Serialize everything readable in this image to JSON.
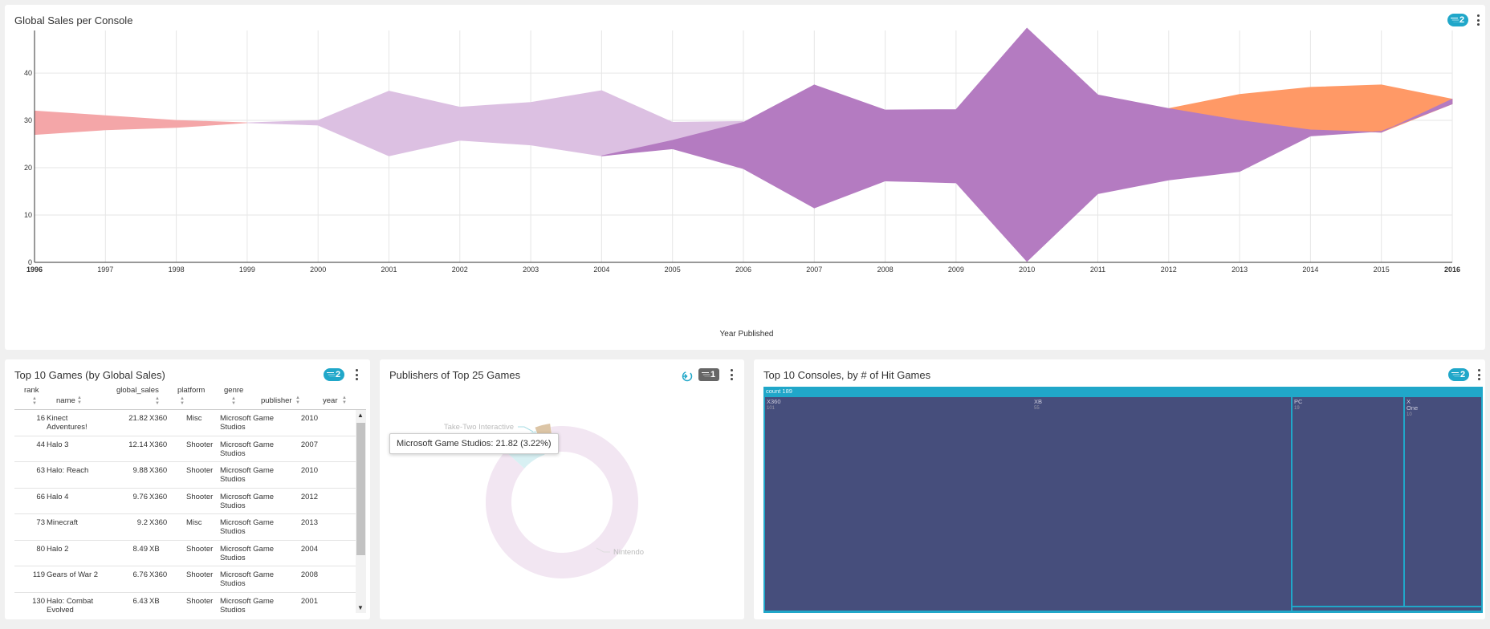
{
  "colors": {
    "accent": "#20a7c9",
    "series_pink": "#f4a6a8",
    "series_lavender": "#dcc0e2",
    "series_purple": "#b47bc1",
    "series_orange": "#ff9966",
    "treemap_fill": "#464e7c"
  },
  "top_chart": {
    "title": "Global Sales per Console",
    "filter_count": "2",
    "xlabel": "Year Published"
  },
  "chart_data": [
    {
      "type": "area",
      "title": "Global Sales per Console",
      "xlabel": "Year Published",
      "ylabel": "",
      "x": [
        1996,
        1997,
        1998,
        1999,
        2000,
        2001,
        2002,
        2003,
        2004,
        2005,
        2006,
        2007,
        2008,
        2009,
        2010,
        2011,
        2012,
        2013,
        2014,
        2015,
        2016
      ],
      "x_tick_labels": [
        "1996",
        "1997",
        "1998",
        "1999",
        "2000",
        "2001",
        "2002",
        "2003",
        "2004",
        "2005",
        "2006",
        "2007",
        "2008",
        "2009",
        "2010",
        "2011",
        "2012",
        "2013",
        "2014",
        "2015",
        "2016"
      ],
      "y_ticks": [
        0,
        10,
        20,
        30,
        40
      ],
      "ylim": [
        0,
        49
      ],
      "grid": true,
      "bands": [
        {
          "color": "#f4a6a8",
          "years": [
            1996,
            1997,
            1998,
            1999
          ],
          "lower": [
            27,
            28,
            28.5,
            29.5
          ],
          "upper": [
            32,
            31,
            30,
            29.5
          ]
        },
        {
          "color": "#dcc0e2",
          "years": [
            1999,
            2000,
            2001,
            2002,
            2003,
            2004,
            2005,
            2006
          ],
          "lower": [
            29.5,
            29,
            22.5,
            25.8,
            24.8,
            22.5,
            25.3,
            29.3
          ],
          "upper": [
            29.5,
            30,
            36.2,
            32.8,
            33.8,
            36.3,
            29.6,
            29.8
          ]
        },
        {
          "color": "#ff9966",
          "years": [
            2012,
            2013,
            2014,
            2015,
            2016
          ],
          "lower": [
            32.5,
            30,
            28,
            27.5,
            33.5
          ],
          "upper": [
            32.5,
            35.5,
            37,
            37.5,
            34.5
          ]
        },
        {
          "color": "#b47bc1",
          "years": [
            2004,
            2005,
            2006,
            2007,
            2008,
            2009,
            2010,
            2011,
            2012,
            2013,
            2014,
            2015,
            2016
          ],
          "lower": [
            22.5,
            24,
            19.8,
            11.5,
            17.2,
            16.8,
            0.2,
            14.5,
            17.4,
            19.2,
            26.7,
            27.7,
            33.5
          ],
          "upper": [
            22.5,
            25.8,
            29.6,
            37.5,
            32.2,
            32.3,
            49.5,
            35.4,
            32.5,
            30,
            28,
            27.5,
            34.5
          ]
        }
      ]
    },
    {
      "type": "pie",
      "title": "Publishers of Top 25 Games",
      "slices": [
        {
          "label": "Microsoft Game Studios",
          "value": 21.82,
          "percent": 3.22,
          "color": "#dcc5a6"
        },
        {
          "label": "Take-Two Interactive",
          "value": null,
          "color": "#d8f0f3"
        },
        {
          "label": "Nintendo",
          "value": null,
          "color": "#f2e6f2"
        }
      ]
    }
  ],
  "table": {
    "title": "Top 10 Games (by Global Sales)",
    "filter_count": "2",
    "columns": [
      "rank",
      "name",
      "global_sales",
      "platform",
      "genre",
      "publisher",
      "year"
    ],
    "rows": [
      {
        "rank": "16",
        "name": [
          "Kinect",
          "Adventures!"
        ],
        "global_sales": "21.82",
        "platform": "X360",
        "genre": "Misc",
        "publisher": [
          "Microsoft Game",
          "Studios"
        ],
        "year": "2010"
      },
      {
        "rank": "44",
        "name": [
          "Halo 3"
        ],
        "global_sales": "12.14",
        "platform": "X360",
        "genre": "Shooter",
        "publisher": [
          "Microsoft Game",
          "Studios"
        ],
        "year": "2007"
      },
      {
        "rank": "63",
        "name": [
          "Halo: Reach"
        ],
        "global_sales": "9.88",
        "platform": "X360",
        "genre": "Shooter",
        "publisher": [
          "Microsoft Game",
          "Studios"
        ],
        "year": "2010"
      },
      {
        "rank": "66",
        "name": [
          "Halo 4"
        ],
        "global_sales": "9.76",
        "platform": "X360",
        "genre": "Shooter",
        "publisher": [
          "Microsoft Game",
          "Studios"
        ],
        "year": "2012"
      },
      {
        "rank": "73",
        "name": [
          "Minecraft"
        ],
        "global_sales": "9.2",
        "platform": "X360",
        "genre": "Misc",
        "publisher": [
          "Microsoft Game",
          "Studios"
        ],
        "year": "2013"
      },
      {
        "rank": "80",
        "name": [
          "Halo 2"
        ],
        "global_sales": "8.49",
        "platform": "XB",
        "genre": "Shooter",
        "publisher": [
          "Microsoft Game",
          "Studios"
        ],
        "year": "2004"
      },
      {
        "rank": "119",
        "name": [
          "Gears of War 2"
        ],
        "global_sales": "6.76",
        "platform": "X360",
        "genre": "Shooter",
        "publisher": [
          "Microsoft Game",
          "Studios"
        ],
        "year": "2008"
      },
      {
        "rank": "130",
        "name": [
          "Halo: Combat",
          "Evolved"
        ],
        "global_sales": "6.43",
        "platform": "XB",
        "genre": "Shooter",
        "publisher": [
          "Microsoft Game",
          "Studios"
        ],
        "year": "2001"
      }
    ]
  },
  "donut": {
    "title": "Publishers of Top 25 Games",
    "filter_count": "1",
    "tooltip": "Microsoft Game Studios: 21.82 (3.22%)",
    "label_take_two": "Take-Two Interactive",
    "label_nintendo": "Nintendo"
  },
  "treemap": {
    "title": "Top 10 Consoles, by # of Hit Games",
    "filter_count": "2",
    "header": "count 189",
    "cells": [
      {
        "label": "X360",
        "value": "101"
      },
      {
        "label": "XB",
        "value": "55"
      },
      {
        "label": "PC",
        "value": "19"
      },
      {
        "label": "X\nOne",
        "value": "10"
      }
    ]
  }
}
